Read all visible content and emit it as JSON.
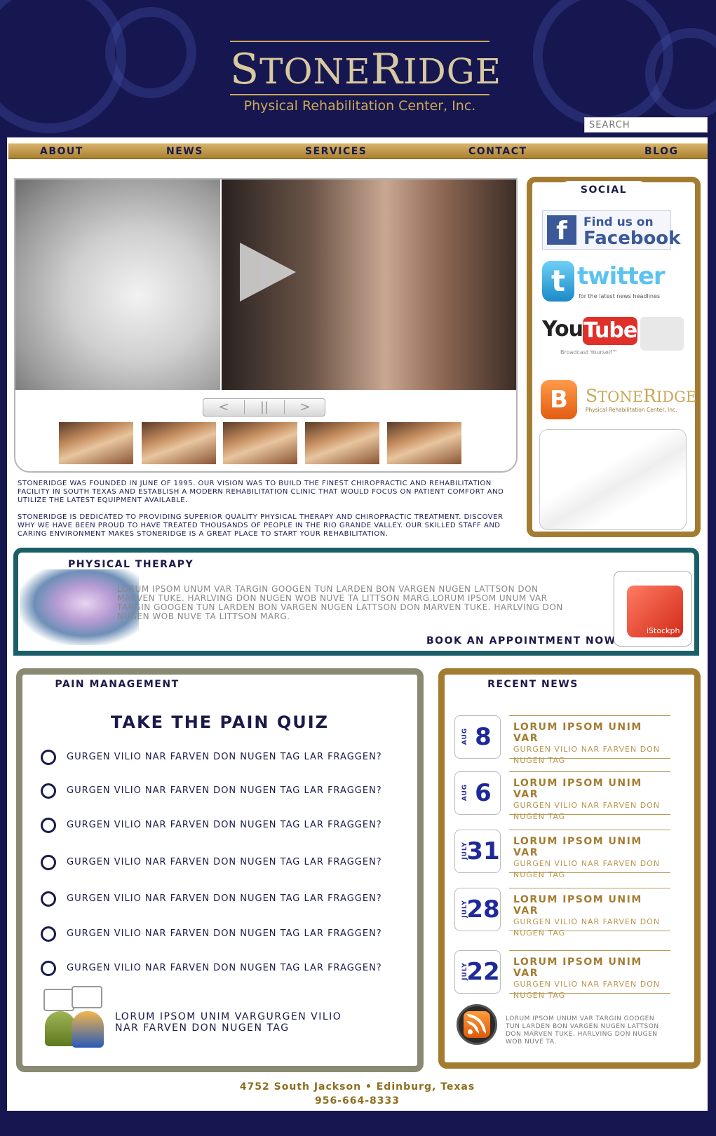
{
  "brand": {
    "name": "StoneRidge",
    "name_cap1": "S",
    "name_mid1": "TONE",
    "name_cap2": "R",
    "name_mid2": "IDGE",
    "tagline": "Physical Rehabilitation Center, Inc."
  },
  "search": {
    "placeholder": "SEARCH"
  },
  "nav": [
    "ABOUT",
    "NEWS",
    "SERVICES",
    "CONTACT",
    "BLOG"
  ],
  "video": {
    "controls": {
      "prev": "<",
      "pause": "||",
      "next": ">"
    },
    "thumbnail_count": 5
  },
  "intro": [
    "STONERIDGE WAS FOUNDED IN JUNE OF 1995. OUR VISION WAS TO BUILD THE FINEST CHIROPRACTIC AND REHABILITATION FACILITY IN SOUTH TEXAS AND ESTABLISH A MODERN REHABILITATION CLINIC THAT WOULD FOCUS ON PATIENT COMFORT AND UTILIZE THE LATEST EQUIPMENT AVAILABLE.",
    "STONERIDGE IS DEDICATED TO PROVIDING SUPERIOR QUALITY PHYSICAL THERAPY AND CHIROPRACTIC TREATMENT. DISCOVER WHY WE HAVE BEEN PROUD TO HAVE TREATED THOUSANDS OF PEOPLE IN THE RIO GRANDE VALLEY. OUR SKILLED STAFF AND CARING ENVIRONMENT MAKES STONERIDGE IS A GREAT PLACE TO START YOUR REHABILITATION."
  ],
  "social": {
    "title": "SOCIAL",
    "facebook": {
      "icon": "f",
      "line1": "Find us on",
      "line2": "Facebook"
    },
    "twitter": {
      "icon": "t",
      "word": "twitter",
      "sub": "for the latest news headlines"
    },
    "youtube": {
      "you": "You",
      "tube": "Tube",
      "sub": "Broadcast Yourself™"
    },
    "blog": {
      "icon": "B",
      "cap1": "S",
      "mid1": "TONE",
      "cap2": "R",
      "mid2": "IDGE",
      "sub": "Physical Rehabilitation Center, Inc."
    }
  },
  "physical_therapy": {
    "title": "PHYSICAL THERAPY",
    "text": "LORUM IPSOM UNUM VAR TARGIN GOOGEN TUN LARDEN BON VARGEN NUGEN LATTSON DON MARVEN TUKE. HARLVING DON NUGEN WOB NUVE TA LITTSON MARG.LORUM IPSOM UNUM VAR TARGIN GOOGEN TUN LARDEN BON VARGEN NUGEN LATTSON DON MARVEN TUKE. HARLVING DON NUGEN WOB NUVE TA LITTSON MARG.",
    "cta": "BOOK AN APPOINTMENT NOW",
    "watermark": "iStockph"
  },
  "pain_management": {
    "title": "PAIN MANAGEMENT",
    "quiz_title": "TAKE THE PAIN QUIZ",
    "questions": [
      "GURGEN VILIO NAR FARVEN DON NUGEN TAG LAR FRAGGEN?",
      "GURGEN VILIO NAR FARVEN DON NUGEN TAG LAR FRAGGEN?",
      "GURGEN VILIO NAR FARVEN DON NUGEN TAG LAR FRAGGEN?",
      "GURGEN VILIO NAR FARVEN DON NUGEN TAG LAR FRAGGEN?",
      "GURGEN VILIO NAR FARVEN DON NUGEN TAG LAR FRAGGEN?",
      "GURGEN VILIO NAR FARVEN DON NUGEN TAG LAR FRAGGEN?",
      "GURGEN VILIO NAR FARVEN DON NUGEN TAG LAR FRAGGEN?"
    ],
    "footer_text": "LORUM IPSOM UNIM VARGURGEN VILIO NAR FARVEN DON NUGEN TAG"
  },
  "recent_news": {
    "title": "RECENT NEWS",
    "items": [
      {
        "month": "AUG",
        "day": "8",
        "headline": "LORUM IPSOM UNIM VAR",
        "summary": "GURGEN VILIO NAR FARVEN DON NUGEN TAG"
      },
      {
        "month": "AUG",
        "day": "6",
        "headline": "LORUM IPSOM UNIM VAR",
        "summary": "GURGEN VILIO NAR FARVEN DON NUGEN TAG"
      },
      {
        "month": "JULY",
        "day": "31",
        "headline": "LORUM IPSOM UNIM VAR",
        "summary": "GURGEN VILIO NAR FARVEN DON NUGEN TAG"
      },
      {
        "month": "JULY",
        "day": "28",
        "headline": "LORUM IPSOM UNIM VAR",
        "summary": "GURGEN VILIO NAR FARVEN DON NUGEN TAG"
      },
      {
        "month": "JULY",
        "day": "22",
        "headline": "LORUM IPSOM UNIM VAR",
        "summary": "GURGEN VILIO NAR FARVEN DON NUGEN TAG"
      }
    ],
    "rss_text": "LORUM IPSOM UNUM VAR TARGIN GOOGEN TUN LARDEN BON VARGEN NUGEN LATTSON DON MARVEN TUKE. HARLVING DON NUGEN WOB NUVE TA."
  },
  "footer": {
    "address": "4752 South Jackson • Edinburg, Texas",
    "phone": "956-664-8333"
  },
  "colors": {
    "background": "#161650",
    "gold": "#a47c31",
    "teal": "#1a5e68",
    "olive": "#8a8a72",
    "navy_text": "#1a1a4a"
  },
  "icons": [
    "play-icon",
    "facebook-icon",
    "twitter-icon",
    "youtube-icon",
    "blogger-icon",
    "calendar-icon",
    "people-icon",
    "rss-icon"
  ]
}
